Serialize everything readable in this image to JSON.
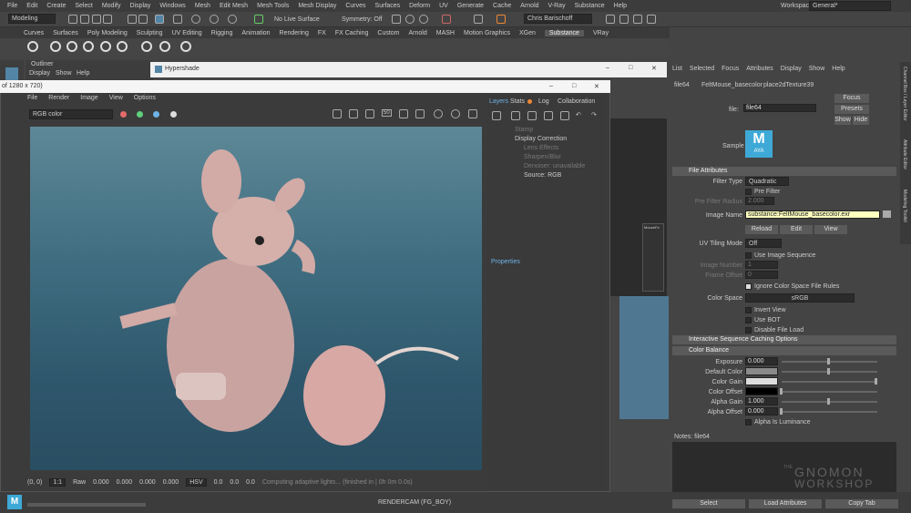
{
  "menubar": {
    "items": [
      "File",
      "Edit",
      "Create",
      "Select",
      "Modify",
      "Display",
      "Windows",
      "Mesh",
      "Edit Mesh",
      "Mesh Tools",
      "Mesh Display",
      "Curves",
      "Surfaces",
      "Deform",
      "UV",
      "Generate",
      "Cache",
      "Arnold",
      "V-Ray",
      "Substance",
      "Help"
    ],
    "workspace_label": "Workspace:",
    "workspace_value": "General*"
  },
  "toolbar": {
    "mode": "Modeling",
    "live_surface": "No Live Surface",
    "symmetry": "Symmetry: Off",
    "user": "Chris Barischoff"
  },
  "shelf": {
    "tabs": [
      "Curves",
      "Surfaces",
      "Poly Modeling",
      "Sculpting",
      "UV Editing",
      "Rigging",
      "Animation",
      "Rendering",
      "FX",
      "FX Caching",
      "Custom",
      "Arnold",
      "MASH",
      "Motion Graphics",
      "XGen",
      "Substance",
      "VRay"
    ],
    "active": "Substance"
  },
  "outliner": {
    "title": "Outliner",
    "menu": [
      "Display",
      "Show",
      "Help"
    ]
  },
  "hypershade": {
    "title": "Hypershade"
  },
  "renderview": {
    "size_label": "of 1280 x 720)",
    "menu": [
      "File",
      "Render",
      "Image",
      "View",
      "Options"
    ],
    "channel": "RGB color",
    "status_coords": "(0, 0)",
    "zoom": "1:1",
    "raw_label": "Raw",
    "raw_values": [
      "0.000",
      "0.000",
      "0.000",
      "0.000"
    ],
    "colorspace": "HSV",
    "hsv_values": [
      "0.0",
      "0.0",
      "0.0"
    ],
    "progress": "Computing adaptive lights... (finished in | 0h 0m 0.0s)",
    "camera": "RENDERCAM (FG_BOY)",
    "res_btn": "50"
  },
  "layers": {
    "tabs": [
      "Layers",
      "Stats",
      "Log",
      "Collaboration"
    ],
    "items": [
      "Stamp",
      "Display Correction",
      "Lens Effects",
      "Sharpen/Blur",
      "Denoiser: unavailable",
      "Source: RGB"
    ],
    "props_title": "Properties",
    "node_label": "MouseFe"
  },
  "ae": {
    "menu": [
      "List",
      "Selected",
      "Focus",
      "Attributes",
      "Display",
      "Show",
      "Help"
    ],
    "tabs": [
      "file64",
      "FeltMouse_basecolor",
      "place2dTexture39"
    ],
    "file_label": "file:",
    "file_value": "file64",
    "focus": "Focus",
    "presets": "Presets",
    "show": "Show",
    "hide": "Hide",
    "sample": "Sample",
    "logo": "M",
    "logo_sub": "AYA",
    "file_attr": "File Attributes",
    "filter_type_label": "Filter Type",
    "filter_type": "Quadratic",
    "pre_filter": "Pre Filter",
    "pre_filter_radius_label": "Pre Filter Radius",
    "pre_filter_radius": "2.000",
    "image_name_label": "Image Name",
    "image_name": "substance:FeltMouse_basecolor.exr",
    "reload": "Reload",
    "edit": "Edit",
    "view": "View",
    "uv_tiling_label": "UV Tiling Mode",
    "uv_tiling": "Off",
    "use_image_seq": "Use Image Sequence",
    "image_number_label": "Image Number",
    "image_number": "1",
    "frame_offset_label": "Frame Offset",
    "frame_offset": "0",
    "ignore_cs": "Ignore Color Space File Rules",
    "color_space_label": "Color Space",
    "color_space": "sRGB",
    "invert": "Invert View",
    "use_bot": "Use BOT",
    "disable_load": "Disable File Load",
    "interactive_seq": "Interactive Sequence Caching Options",
    "color_balance": "Color Balance",
    "exposure_label": "Exposure",
    "exposure": "0.000",
    "default_color_label": "Default Color",
    "color_gain_label": "Color Gain",
    "color_offset_label": "Color Offset",
    "alpha_gain_label": "Alpha Gain",
    "alpha_gain": "1.000",
    "alpha_offset_label": "Alpha Offset",
    "alpha_offset": "0.000",
    "alpha_lum": "Alpha Is Luminance",
    "notes": "Notes: file64",
    "select": "Select",
    "load_attr": "Load Attributes",
    "copy_tab": "Copy Tab",
    "side_tabs": [
      "Channel Box / Layer Editor",
      "Attribute Editor",
      "Modeling Toolkit"
    ]
  },
  "watermark": {
    "line1": "THE",
    "line2": "GNOMON",
    "line3": "WORKSHOP"
  },
  "colors": {
    "accent": "#5285a6",
    "bg": "#444444",
    "highlight": "#ffffc0"
  }
}
